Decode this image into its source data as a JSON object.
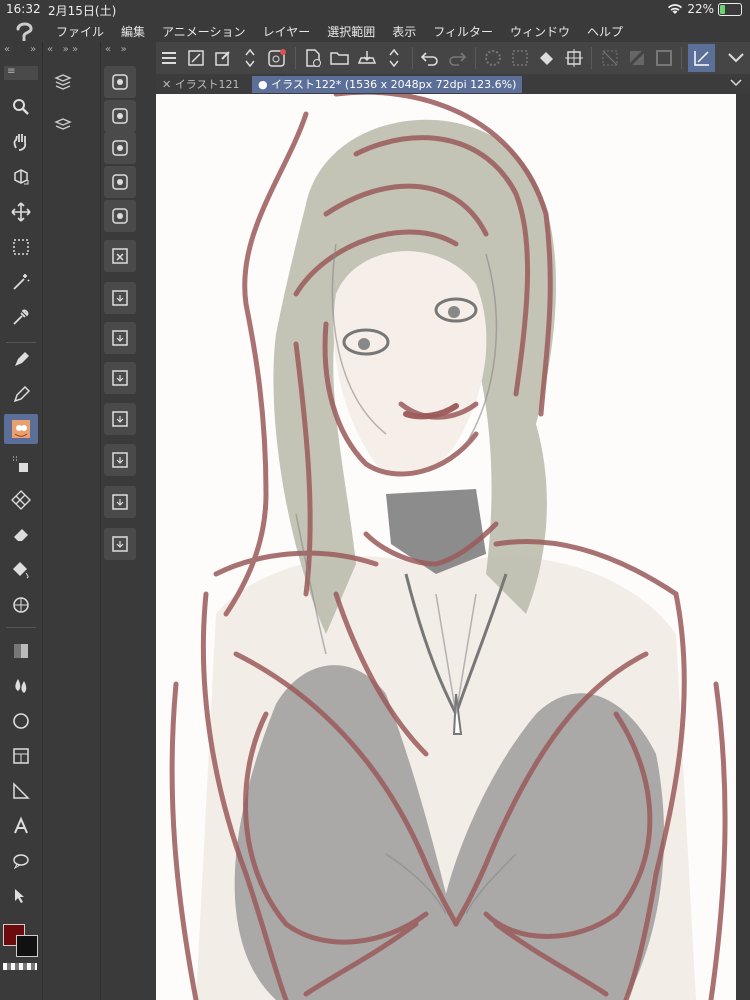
{
  "status": {
    "time": "16:32",
    "date": "2月15日(土)",
    "battery": "22%"
  },
  "menu": [
    "ファイル",
    "編集",
    "アニメーション",
    "レイヤー",
    "選択範囲",
    "表示",
    "フィルター",
    "ウィンドウ",
    "ヘルプ"
  ],
  "tabs": [
    {
      "label": "イラスト121",
      "prefix": "✕"
    },
    {
      "label": "イラスト122* (1536 x 2048px 72dpi 123.6%)",
      "prefix": "●"
    }
  ],
  "tools": [
    "zoom-icon",
    "hand-icon",
    "rotate-icon",
    "move-icon",
    "select-rect-icon",
    "magic-wand-icon",
    "eyedropper-icon",
    "pen-icon",
    "pencil-icon",
    "brush-preset",
    "airbrush-icon",
    "decoration-icon",
    "eraser-icon",
    "fill-icon",
    "transform-icon",
    "gradient-icon",
    "blend-icon",
    "circle-icon",
    "frame-icon",
    "ruler-icon",
    "text-icon",
    "balloon-icon",
    "operation-icon"
  ],
  "colors": {
    "main": "#6b0b0b",
    "sub": "#111111",
    "accent": "#5c6f98",
    "sketch": "#9b5b5b"
  }
}
